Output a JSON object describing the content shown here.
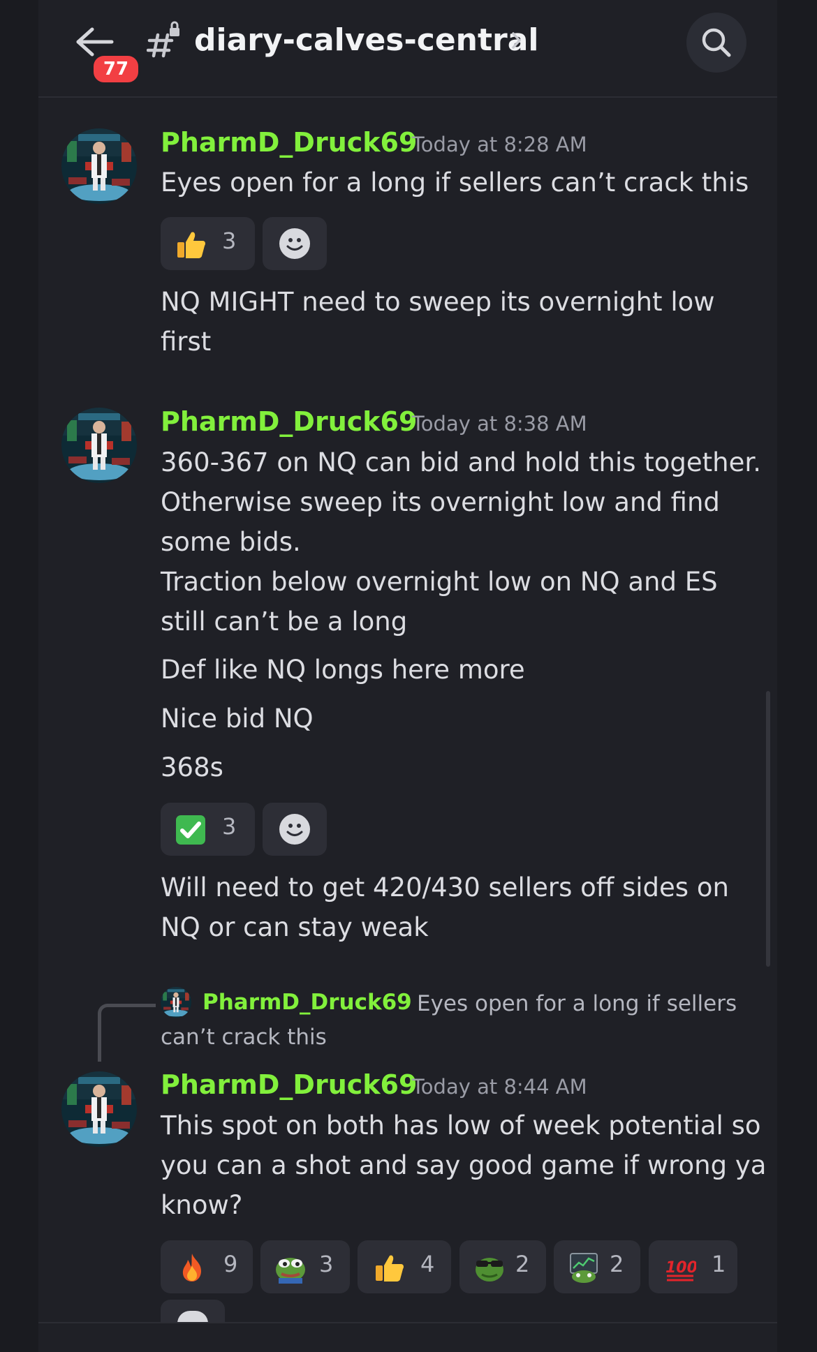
{
  "header": {
    "unread_count": "77",
    "channel_name": "diary-calves-central",
    "icons": [
      "back-arrow-icon",
      "locked-hash-icon",
      "chevron-right-icon",
      "search-icon"
    ]
  },
  "messages": [
    {
      "author": "PharmD_Druck69",
      "timestamp": "Today at 8:28 AM",
      "lines": [
        "Eyes open for a long if sellers can’t crack this"
      ],
      "reactions": [
        {
          "emoji": "thumbs-up",
          "count": "3"
        }
      ]
    },
    {
      "continued": true,
      "lines": [
        "NQ MIGHT need to sweep its overnight low",
        "first"
      ]
    },
    {
      "author": "PharmD_Druck69",
      "timestamp": "Today at 8:38 AM",
      "lines": [
        "360-367 on NQ can bid and hold this together.",
        "Otherwise sweep its overnight low and find",
        "some bids.",
        "Traction below overnight low on NQ and ES",
        "still can’t be a long"
      ],
      "followups": [
        "Def like NQ longs here more",
        "Nice bid NQ",
        "368s"
      ],
      "reactions": [
        {
          "emoji": "check-mark",
          "count": "3"
        }
      ]
    },
    {
      "continued": true,
      "lines": [
        "Will need to get 420/430 sellers off sides on",
        "NQ or can stay weak"
      ]
    },
    {
      "reply_to": {
        "author": "PharmD_Druck69",
        "text_line1": "Eyes open for a long if sellers",
        "text_line2": "can’t crack this"
      },
      "author": "PharmD_Druck69",
      "timestamp": "Today at 8:44 AM",
      "lines": [
        "This spot on both has low of week potential so",
        "you can a shot and say good game if wrong ya",
        "know?"
      ],
      "reactions": [
        {
          "emoji": "fire",
          "count": "9"
        },
        {
          "emoji": "pepe-frog",
          "count": "3"
        },
        {
          "emoji": "thumbs-up",
          "count": "4"
        },
        {
          "emoji": "frog-sunglasses",
          "count": "2"
        },
        {
          "emoji": "frog-screen",
          "count": "2"
        },
        {
          "emoji": "hundred-points",
          "count": "1"
        }
      ]
    }
  ],
  "colors": {
    "background": "#1f2026",
    "username": "#82f03c",
    "timestamp": "#9a9ca6",
    "text": "#dcdde2",
    "badge": "#f23f43",
    "reaction_bg": "#2d2e36"
  }
}
